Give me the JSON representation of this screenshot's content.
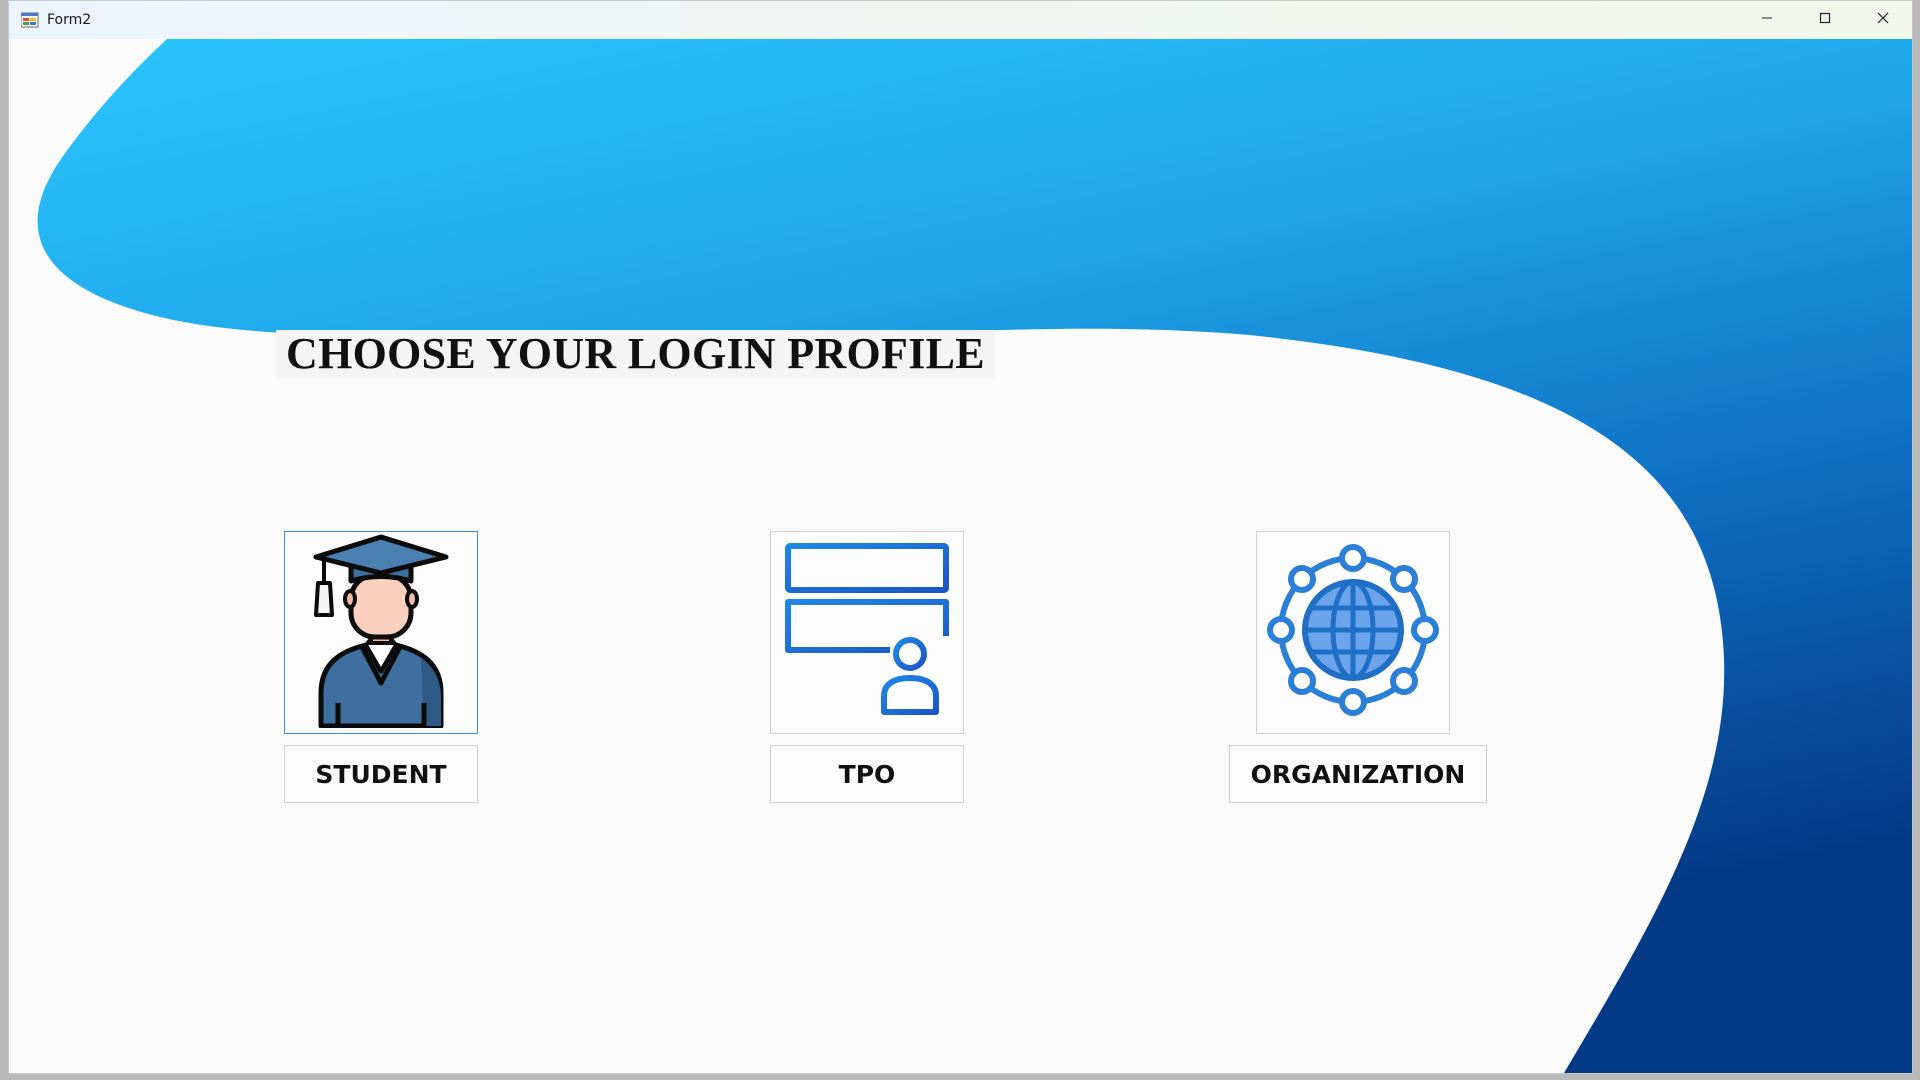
{
  "window": {
    "title": "Form2",
    "controls": {
      "minimize_icon": "minimize-icon",
      "maximize_icon": "maximize-icon",
      "close_icon": "close-icon"
    }
  },
  "main": {
    "heading": "CHOOSE YOUR LOGIN PROFILE",
    "profiles": [
      {
        "label": "STUDENT",
        "icon": "graduate-icon",
        "selected": true
      },
      {
        "label": "TPO",
        "icon": "server-user-icon",
        "selected": false
      },
      {
        "label": "ORGANIZATION",
        "icon": "globe-network-icon",
        "selected": false
      }
    ]
  },
  "colors": {
    "accent_light": "#2bc4fe",
    "accent_mid": "#1f9be0",
    "accent_dark": "#033a86",
    "background": "#fafafa"
  }
}
